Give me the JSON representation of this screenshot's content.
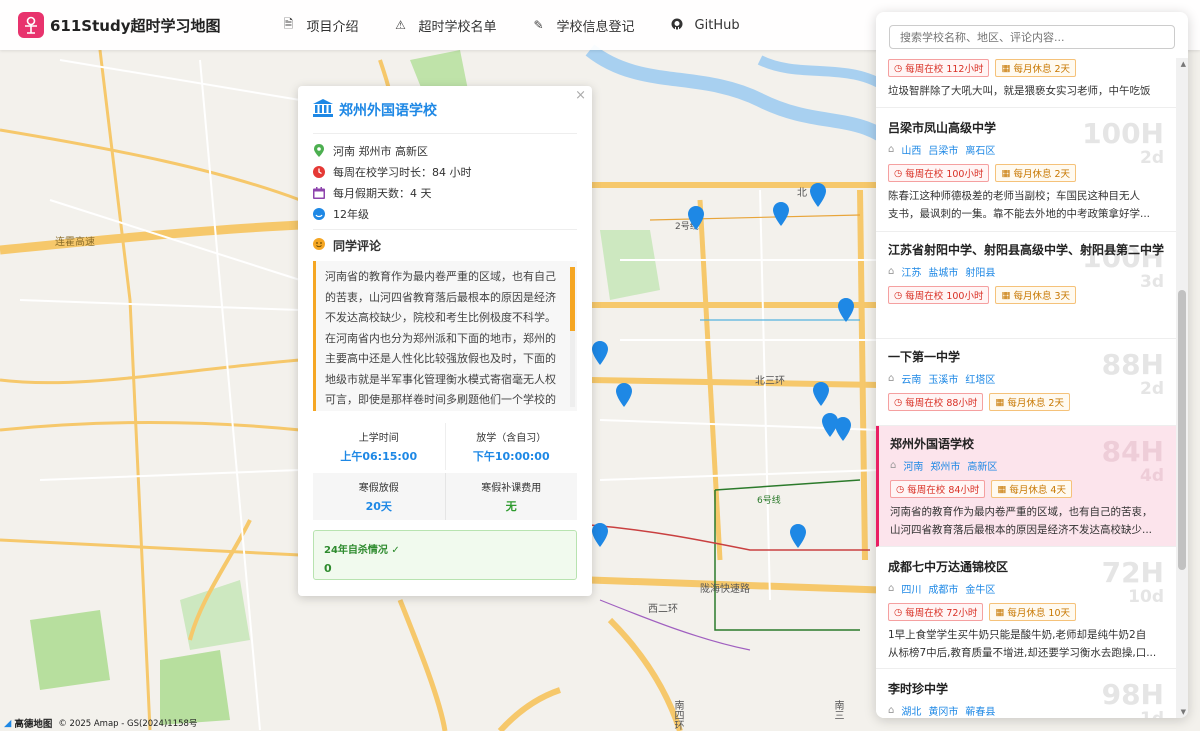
{
  "app": {
    "title": "611Study超时学习地图"
  },
  "nav": [
    {
      "label": "项目介绍",
      "icon": "document-icon"
    },
    {
      "label": "超时学校名单",
      "icon": "warning-icon"
    },
    {
      "label": "学校信息登记",
      "icon": "edit-icon"
    },
    {
      "label": "GitHub",
      "icon": "github-icon"
    }
  ],
  "map": {
    "labels": {
      "expressway": "连霍高速",
      "north3": "北三环",
      "north": "北",
      "longhai": "陇海快速路",
      "west2": "西二环",
      "south4": "南四环",
      "south3": "南三",
      "line6": "6号线",
      "line2": "2号线"
    },
    "attribution": "高德地图",
    "copyright": "© 2025 Amap - GS(2024)1158号"
  },
  "detail": {
    "close": "×",
    "name": "郑州外国语学校",
    "location": "河南 郑州市 高新区",
    "weekly_hours": "每周在校学习时长：84 小时",
    "monthly_rest": "每月假期天数：4 天",
    "grade": "12年级",
    "comments_title": "同学评论",
    "comment": "河南省的教育作为最内卷严重的区域，也有自己的苦衷，山河四省教育落后最根本的原因是经济不发达高校缺少，院校和考生比例极度不科学。在河南省内也分为郑州派和下面的地市，郑州的主要高中还是人性化比较强放假也及时，下面的地级市就是半军事化管理衡水模式寄宿毫无人权可言，即使是那样卷时间多刷题他们一个学校的一本率也低的可怜，越差的学校校规发型等等校",
    "start_label": "上学时间",
    "start_value": "上午06:15:00",
    "end_label": "放学（含自习）",
    "end_value": "下午10:00:00",
    "winter_label": "寒假放假",
    "winter_value": "20天",
    "fee_label": "寒假补课费用",
    "fee_value": "无",
    "suicide_label": "24年自杀情况 ✓",
    "suicide_value": "0"
  },
  "search": {
    "placeholder": "搜索学校名称、地区、评论内容..."
  },
  "schools": [
    {
      "name": "",
      "province": "",
      "city": "",
      "district": "",
      "hours_tag": "每周在校 112小时",
      "rest_tag": "每月休息 2天",
      "desc": "垃圾智胖除了大吼大叫，就是猥亵女实习老师，中午吃饭",
      "big_h": "",
      "big_d": ""
    },
    {
      "name": "吕梁市凤山高级中学",
      "province": "山西",
      "city": "吕梁市",
      "district": "离石区",
      "hours_tag": "每周在校 100小时",
      "rest_tag": "每月休息 2天",
      "desc": "陈春江这种师德极差的老师当副校；车国民这种目无人",
      "desc2": "支书，最讽刺的一集。靠不能去外地的中考政策拿好学...",
      "big_h": "100H",
      "big_d": "2d"
    },
    {
      "name": "江苏省射阳中学、射阳县高级中学、射阳县第二中学",
      "province": "江苏",
      "city": "盐城市",
      "district": "射阳县",
      "hours_tag": "每周在校 100小时",
      "rest_tag": "每月休息 3天",
      "big_h": "100H",
      "big_d": "3d"
    },
    {
      "name": "一下第一中学",
      "province": "云南",
      "city": "玉溪市",
      "district": "红塔区",
      "hours_tag": "每周在校 88小时",
      "rest_tag": "每月休息 2天",
      "big_h": "88H",
      "big_d": "2d"
    },
    {
      "name": "郑州外国语学校",
      "province": "河南",
      "city": "郑州市",
      "district": "高新区",
      "hours_tag": "每周在校 84小时",
      "rest_tag": "每月休息 4天",
      "desc": "河南省的教育作为最内卷严重的区域，也有自己的苦衷，",
      "desc2": "山河四省教育落后最根本的原因是经济不发达高校缺少...",
      "big_h": "84H",
      "big_d": "4d"
    },
    {
      "name": "成都七中万达通锦校区",
      "province": "四川",
      "city": "成都市",
      "district": "金牛区",
      "hours_tag": "每周在校 72小时",
      "rest_tag": "每月休息 10天",
      "desc": "1早上食堂学生买牛奶只能是酸牛奶,老师却是纯牛奶2自",
      "desc2": "从标榜7中后,教育质量不增进,却还要学习衡水去跑操,口...",
      "big_h": "72H",
      "big_d": "10d"
    },
    {
      "name": "李时珍中学",
      "province": "湖北",
      "city": "黄冈市",
      "district": "蕲春县",
      "big_h": "98H",
      "big_d": "1d"
    }
  ],
  "colors": {
    "accent": "#1e88e5",
    "brand": "#e8336d",
    "active_bg": "#fce4ec"
  }
}
